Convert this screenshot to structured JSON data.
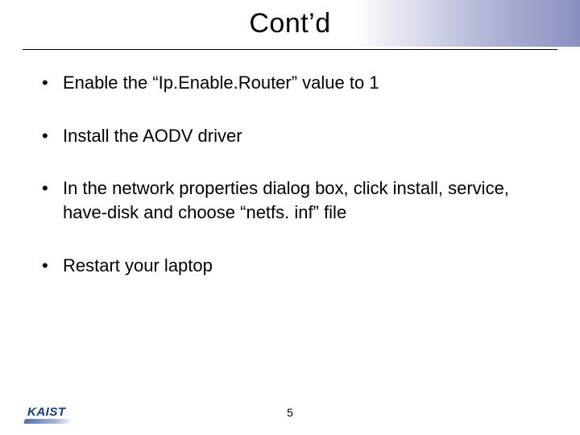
{
  "title": "Cont’d",
  "bullets": [
    "Enable the “Ip.Enable.Router” value to 1",
    "Install the AODV driver",
    "In the network properties dialog box, click install, service, have-disk and choose “netfs. inf” file",
    "Restart your laptop"
  ],
  "page_number": "5",
  "logo_text": "KAIST"
}
